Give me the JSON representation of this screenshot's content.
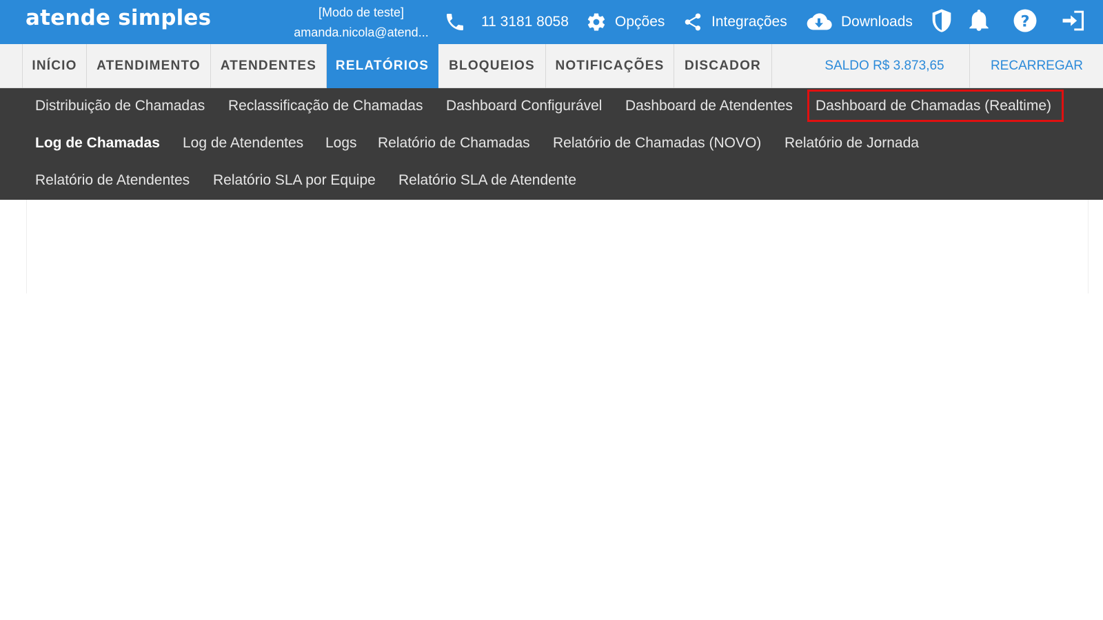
{
  "brand": {
    "logo_text": "atende simples"
  },
  "account": {
    "mode": "[Modo de teste]",
    "email": "amanda.nicola@atend..."
  },
  "topbar": {
    "phone": {
      "icon": "phone-icon",
      "label": "11 3181 8058"
    },
    "options": {
      "icon": "gear-icon",
      "label": "Opções"
    },
    "integrations": {
      "icon": "share-icon",
      "label": "Integrações"
    },
    "downloads": {
      "icon": "cloud-download-icon",
      "label": "Downloads"
    },
    "icons": [
      "shield-icon",
      "bell-icon",
      "help-icon",
      "logout-icon"
    ]
  },
  "nav": {
    "tabs": [
      {
        "label": "INÍCIO"
      },
      {
        "label": "ATENDIMENTO"
      },
      {
        "label": "ATENDENTES"
      },
      {
        "label": "RELATÓRIOS",
        "active": true
      },
      {
        "label": "BLOQUEIOS"
      },
      {
        "label": "NOTIFICAÇÕES"
      },
      {
        "label": "DISCADOR"
      }
    ],
    "balance": "SALDO R$ 3.873,65",
    "recharge": "RECARREGAR"
  },
  "subnav": {
    "items": [
      {
        "label": "Distribuição de Chamadas"
      },
      {
        "label": "Reclassificação de Chamadas"
      },
      {
        "label": "Dashboard Configurável"
      },
      {
        "label": "Dashboard de Atendentes"
      },
      {
        "label": "Dashboard de Chamadas (Realtime)",
        "highlighted": true
      },
      {
        "label": "Log de Chamadas",
        "active": true
      },
      {
        "label": "Log de Atendentes"
      },
      {
        "label": "Logs"
      },
      {
        "label": "Relatório de Chamadas"
      },
      {
        "label": "Relatório de Chamadas (NOVO)"
      },
      {
        "label": "Relatório de Jornada"
      },
      {
        "label": "Relatório de Atendentes"
      },
      {
        "label": "Relatório SLA por Equipe"
      },
      {
        "label": "Relatório SLA de Atendente"
      }
    ]
  },
  "colors": {
    "primary": "#2b8ad9",
    "subnav_bg": "#3c3c3c",
    "highlight": "#e01010"
  }
}
